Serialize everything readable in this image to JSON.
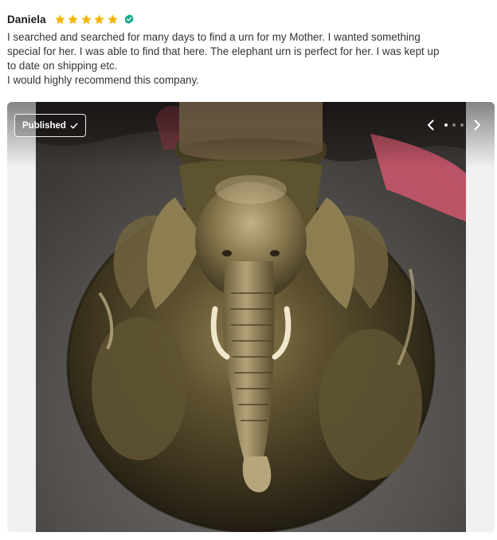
{
  "review": {
    "reviewer_name": "Daniela",
    "rating": 5,
    "rating_max": 5,
    "verified": true,
    "star_color": "#F4B400",
    "verified_color": "#1AA78B",
    "text_lines": [
      "I searched and searched for many days to find a urn for my Mother. I wanted something",
      "special for her. I was able to find that here. The elephant urn is perfect for her. I was kept up",
      "to date on shipping etc.",
      "I would highly recommend this company."
    ]
  },
  "media": {
    "status_label": "Published",
    "status_icon": "check-icon",
    "prev_icon": "chevron-left-icon",
    "next_icon": "chevron-right-icon",
    "slide_count": 3,
    "current_slide": 1,
    "photo_subject": "elephant-urn-photo"
  }
}
